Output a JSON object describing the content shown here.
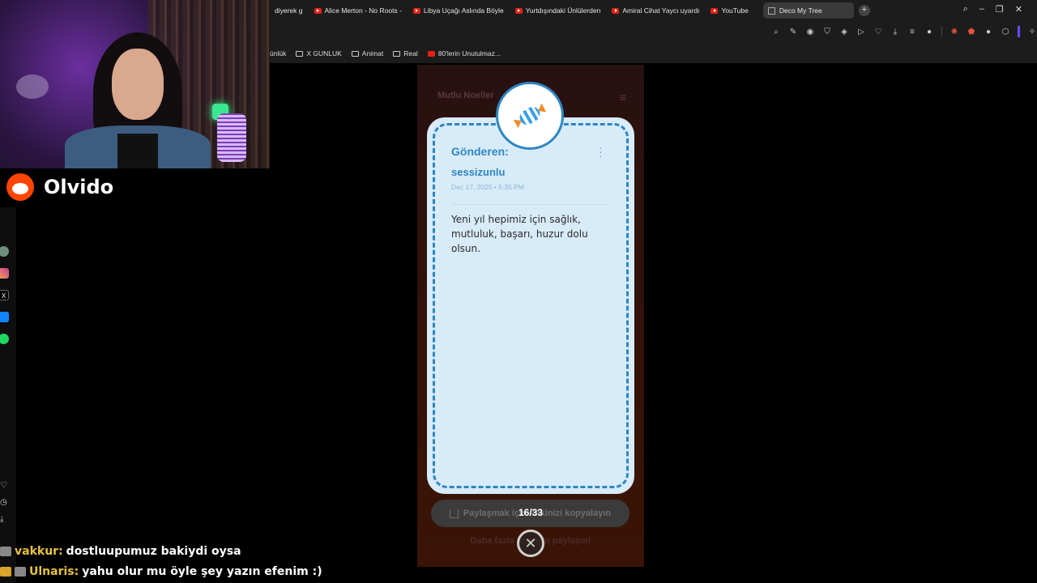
{
  "browser": {
    "tabs": [
      {
        "label": "diyerek g",
        "youtube": false
      },
      {
        "label": "Alice Merton - No Roots -",
        "youtube": true
      },
      {
        "label": "Libya Uçağı Aslında Böyle",
        "youtube": true
      },
      {
        "label": "Yurtdışındaki Ünlülerden",
        "youtube": true
      },
      {
        "label": "Amiral Cihat Yaycı uyardı",
        "youtube": true
      },
      {
        "label": "YouTube",
        "youtube": true
      }
    ],
    "active_tab": "Deco My Tree",
    "new_tab": "+",
    "bookmarks": [
      {
        "label": "ünlük",
        "type": "none"
      },
      {
        "label": "X GUNLUK",
        "type": "folder"
      },
      {
        "label": "Animat",
        "type": "folder"
      },
      {
        "label": "Real",
        "type": "folder"
      },
      {
        "label": "80'lerin Unutulmaz...",
        "type": "youtube"
      }
    ]
  },
  "stream": {
    "reddit_name": "Olvido",
    "chat": [
      {
        "user": "vakkur:",
        "text": "dostluupumuz bakiydi oysa",
        "badge": "gray"
      },
      {
        "user": "Ulnaris:",
        "text": "yahu olur mu öyle şey yazın efenim :)",
        "badge": "gold"
      }
    ]
  },
  "page": {
    "header_title": "Mutlu Noeller",
    "letter": {
      "icon": "candy-icon",
      "from_label": "Gönderen:",
      "sender": "sessizunlu",
      "date": "Dec 17, 2025 • 5:35 PM",
      "message": "Yeni yıl hepimiz için sağlık, mutluluk, başarı, huzur dolu olsun."
    },
    "share_button": "Paylaşmak için linkinizi kopyalayın",
    "counter": "16/33",
    "more_text": "Daha fazla süs için paylaşın!",
    "close_glyph": "✕"
  },
  "colors": {
    "letter_bg": "#d8ebf8",
    "accent_blue": "#2e86c4",
    "reddit": "#ff4500",
    "chat_user": "#e8c23c"
  }
}
